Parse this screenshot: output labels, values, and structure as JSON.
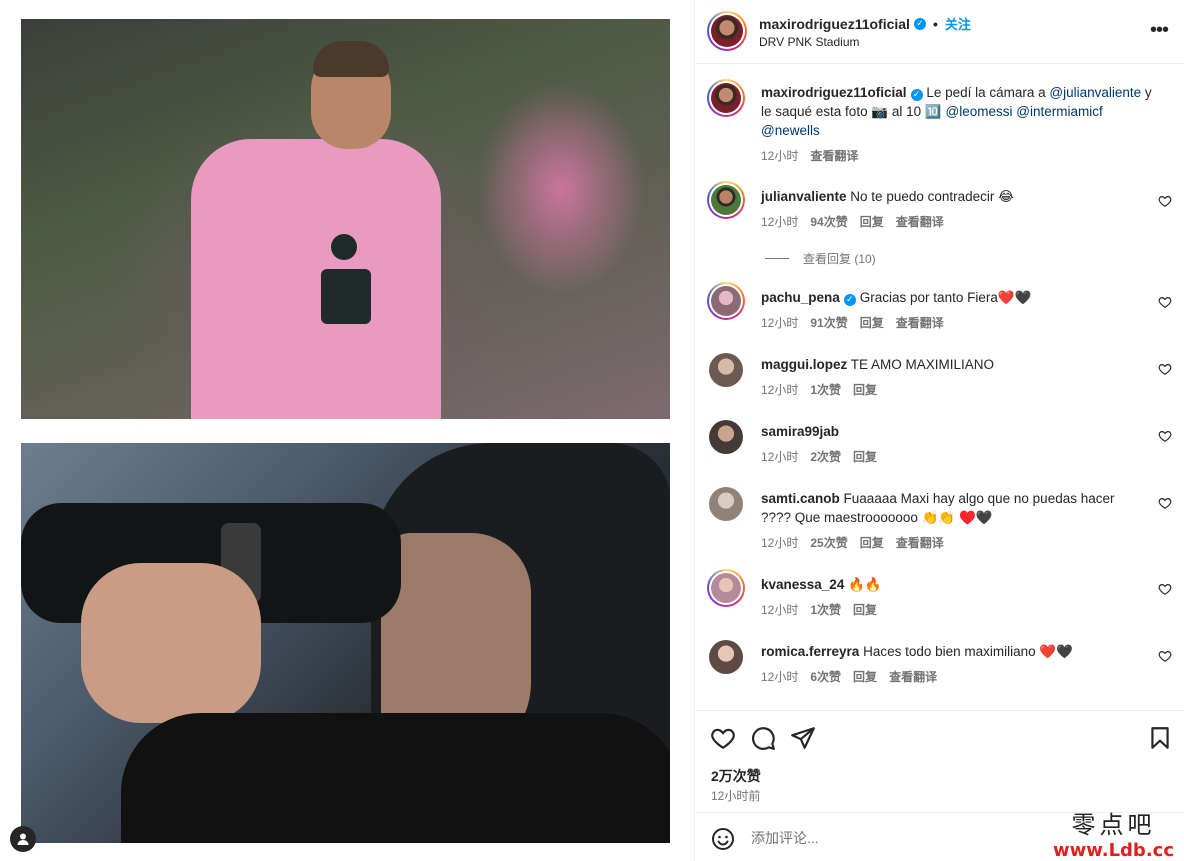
{
  "post": {
    "username": "maxirodriguez11oficial",
    "follow_label": "关注",
    "location": "DRV PNK Stadium",
    "caption": {
      "username": "maxirodriguez11oficial",
      "text_1": " Le pedí la cámara a ",
      "mention_1": "@julianvaliente",
      "text_2": " y le saqué esta foto 📷 al 10 🔟 ",
      "mention_2": "@leomessi",
      "text_3": " ",
      "mention_3": "@intermiamicf",
      "mention_4": "@newells",
      "time": "12小时",
      "translate": "查看翻译"
    }
  },
  "comments": [
    {
      "username": "julianvaliente",
      "text": "No te puedo contradecir 😂",
      "time": "12小时",
      "likes": "94次赞",
      "reply": "回复",
      "translate": "查看翻译",
      "verified": false
    },
    {
      "username": "pachu_pena",
      "text": "Gracias por tanto Fiera❤️🖤",
      "time": "12小时",
      "likes": "91次赞",
      "reply": "回复",
      "translate": "查看翻译",
      "verified": true
    },
    {
      "username": "maggui.lopez",
      "text": "TE AMO MAXIMILIANO",
      "time": "12小时",
      "likes": "1次赞",
      "reply": "回复"
    },
    {
      "username": "samira99jab",
      "text": "",
      "time": "12小时",
      "likes": "2次赞",
      "reply": "回复"
    },
    {
      "username": "samti.canob",
      "text": "Fuaaaaa Maxi hay algo que no puedas hacer ???? Que maestrooooooo 👏👏 ♥️🖤",
      "time": "12小时",
      "likes": "25次赞",
      "reply": "回复",
      "translate": "查看翻译"
    },
    {
      "username": "kvanessa_24",
      "text": "🔥🔥",
      "time": "12小时",
      "likes": "1次赞",
      "reply": "回复"
    },
    {
      "username": "romica.ferreyra",
      "text": "Haces todo bien maximiliano ❤️🖤",
      "time": "12小时",
      "likes": "6次赞",
      "reply": "回复",
      "translate": "查看翻译"
    }
  ],
  "view_replies": "查看回复 (10)",
  "actions": {
    "likes": "2万次赞",
    "time": "12小时前"
  },
  "add_comment": {
    "placeholder": "添加评论..."
  },
  "watermark": {
    "line1": "零点吧",
    "line2": "www.Ldb.cc"
  },
  "colors": {
    "accent": "#0095f6",
    "mention": "#00376b",
    "muted": "#737373",
    "text": "#262626"
  }
}
